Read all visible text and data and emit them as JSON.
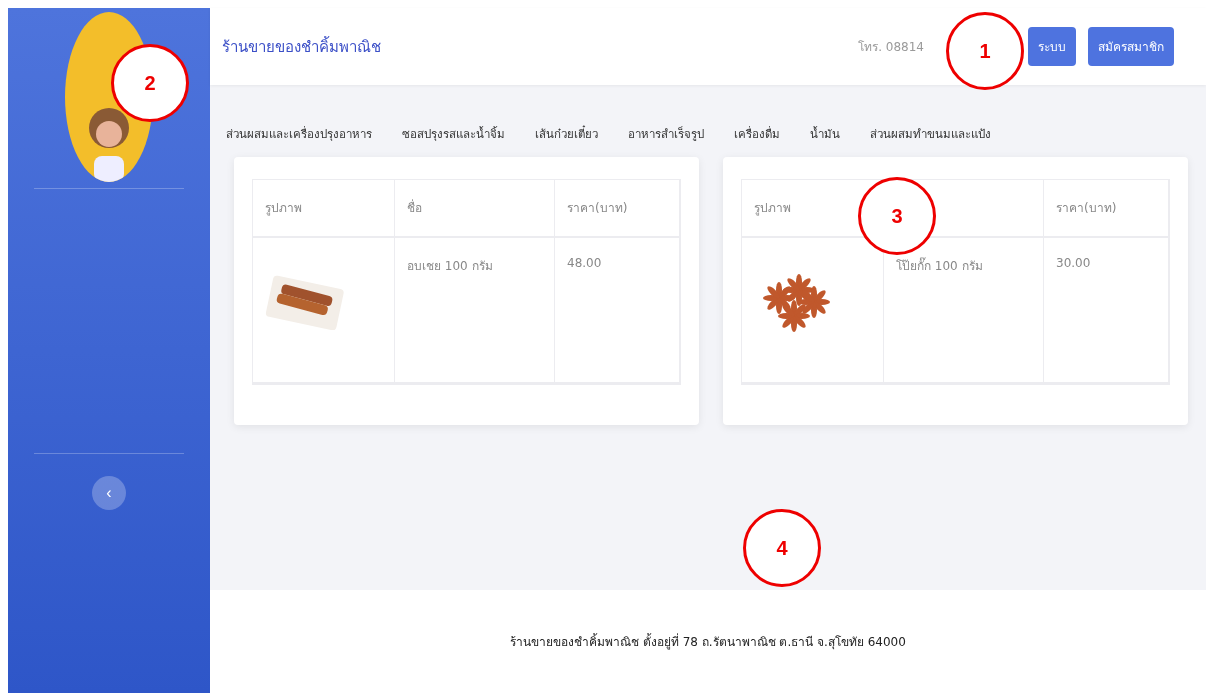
{
  "sidebar": {
    "collapse_button": "‹"
  },
  "header": {
    "shop_name": "ร้านขายของชำคิ้มพาณิช",
    "phone": "โทร. 08814",
    "buttons": [
      {
        "label": "ระบบ"
      },
      {
        "label": "สมัครสมาชิก"
      }
    ]
  },
  "categories": [
    "ส่วนผสมและเครื่องปรุงอาหาร",
    "ซอสปรุงรสและน้ำจิ้ม",
    "เส้นก๋วยเตี๋ยว",
    "อาหารสำเร็จรูป",
    "เครื่องดื่ม",
    "น้ำมัน",
    "ส่วนผสมทำขนมและแป้ง"
  ],
  "products": [
    {
      "columns": [
        {
          "label": "รูปภาพ"
        },
        {
          "label": "ชื่อ"
        },
        {
          "label": "ราคา(บาท)"
        }
      ],
      "row": {
        "kind": "cinnamon",
        "name": "อบเชย 100 กรัม",
        "price": "48.00"
      }
    },
    {
      "columns": [
        {
          "label": "รูปภาพ"
        },
        {},
        {
          "label": "ราคา(บาท)"
        }
      ],
      "row": {
        "kind": "star-anise",
        "name": "โป๊ยกั๊ก 100 กรัม",
        "price": "30.00"
      }
    }
  ],
  "footer": {
    "text": "ร้านขายของชำคิ้มพาณิช ตั้งอยู่ที่ 78 ถ.รัตนาพาณิช ต.ธานี จ.สุโขทัย 64000"
  },
  "annotations": [
    {
      "label": "1"
    },
    {
      "label": "2"
    },
    {
      "label": "3"
    },
    {
      "label": "4"
    }
  ]
}
